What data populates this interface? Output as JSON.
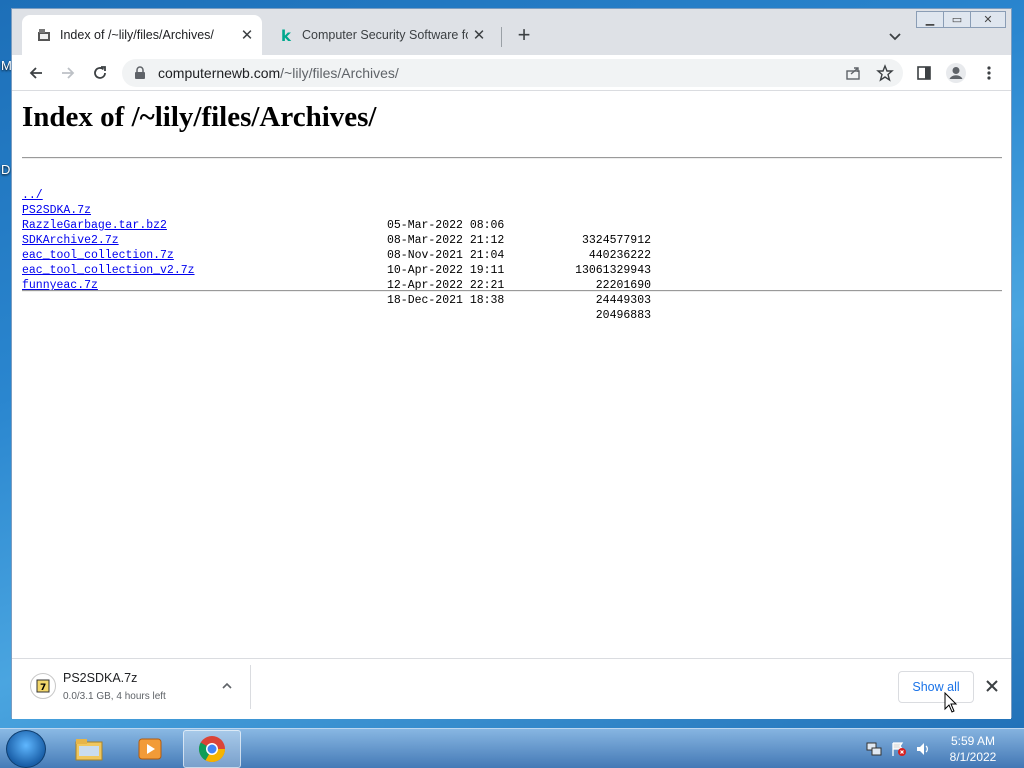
{
  "browser": {
    "tabs": [
      {
        "title": "Index of /~lily/files/Archives/",
        "active": true
      },
      {
        "title": "Computer Security Software for H",
        "active": false
      }
    ],
    "url": {
      "host": "computernewb.com",
      "path": "/~lily/files/Archives/"
    }
  },
  "page": {
    "heading": "Index of /~lily/files/Archives/",
    "parent_link": "../",
    "files": [
      {
        "name": "PS2SDKA.7z",
        "date": "05-Mar-2022 08:06",
        "size": "3324577912"
      },
      {
        "name": "RazzleGarbage.tar.bz2",
        "date": "08-Mar-2022 21:12",
        "size": "440236222"
      },
      {
        "name": "SDKArchive2.7z",
        "date": "08-Nov-2021 21:04",
        "size": "13061329943"
      },
      {
        "name": "eac_tool_collection.7z",
        "date": "10-Apr-2022 19:11",
        "size": "22201690"
      },
      {
        "name": "eac_tool_collection_v2.7z",
        "date": "12-Apr-2022 22:21",
        "size": "24449303"
      },
      {
        "name": "funnyeac.7z",
        "date": "18-Dec-2021 18:38",
        "size": "20496883"
      }
    ]
  },
  "downloads": {
    "item_name": "PS2SDKA.7z",
    "item_status": "0.0/3.1 GB, 4 hours left",
    "show_all_label": "Show all"
  },
  "taskbar": {
    "time": "5:59 AM",
    "date": "8/1/2022"
  },
  "desktop": {
    "letters": [
      "M",
      "D"
    ]
  },
  "colors": {
    "link": "#0000ee",
    "accent": "#1a73e8"
  }
}
